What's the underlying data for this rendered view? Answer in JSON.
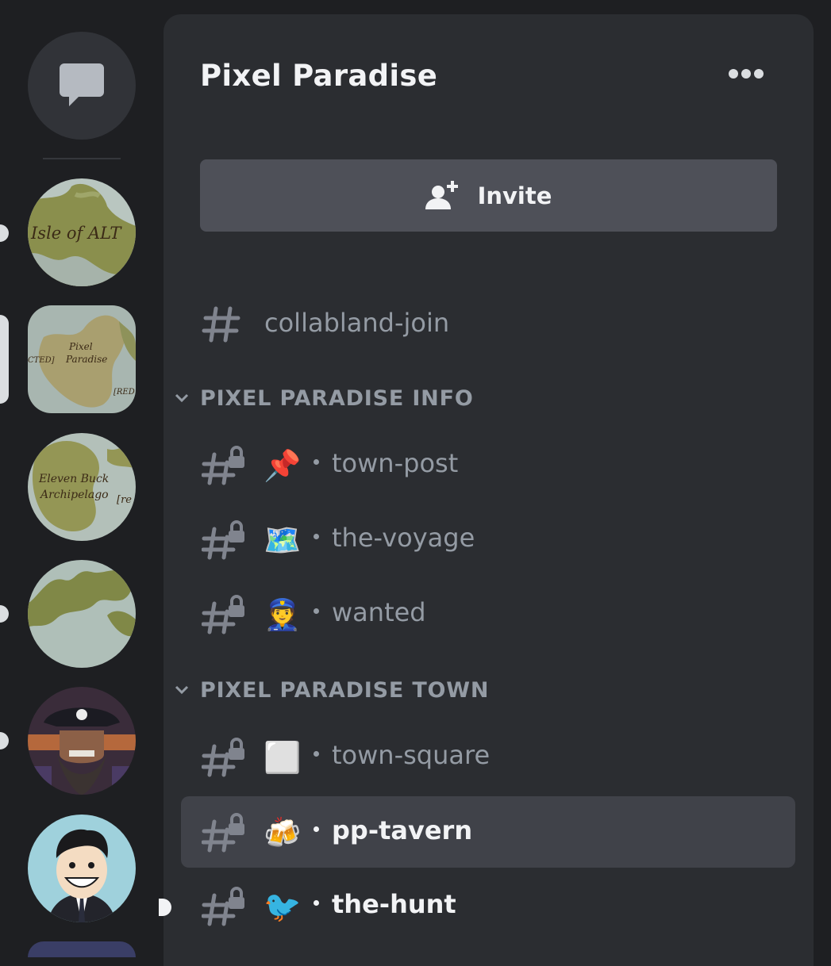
{
  "server": {
    "name": "Pixel Paradise",
    "invite_label": "Invite"
  },
  "rail": {
    "servers": [
      {
        "label": "Isle of ALT",
        "icon": "map-isle-of-alt"
      },
      {
        "label1": "Pixel",
        "label2": "Paradise",
        "left": "CTED]",
        "right": "[RED",
        "icon": "map-pixel-paradise"
      },
      {
        "label1": "Eleven Buck",
        "label2": "Archipelago",
        "right": "[re",
        "icon": "map-eleven-buck"
      },
      {
        "icon": "map-continent"
      },
      {
        "icon": "pirate-avatar"
      },
      {
        "icon": "cartoon-man-avatar"
      }
    ]
  },
  "channels": {
    "top": {
      "name": "collabland-join",
      "icon": "hash-icon"
    },
    "categories": [
      {
        "label": "PIXEL PARADISE INFO",
        "items": [
          {
            "emoji": "📌",
            "name": "town-post"
          },
          {
            "emoji": "🗺️",
            "name": "the-voyage"
          },
          {
            "emoji": "👮",
            "name": "wanted"
          }
        ]
      },
      {
        "label": "PIXEL PARADISE TOWN",
        "items": [
          {
            "emoji": "⬜",
            "name": "town-square"
          },
          {
            "emoji": "🍻",
            "name": "pp-tavern"
          },
          {
            "emoji": "🐦",
            "name": "the-hunt"
          }
        ]
      }
    ]
  },
  "colors": {
    "rail_bg": "#1e1f22",
    "panel_bg": "#2b2d31",
    "active_bg": "#404249",
    "muted_text": "#949ba4",
    "bright_text": "#f2f3f5",
    "invite_bg": "#4e5058"
  }
}
